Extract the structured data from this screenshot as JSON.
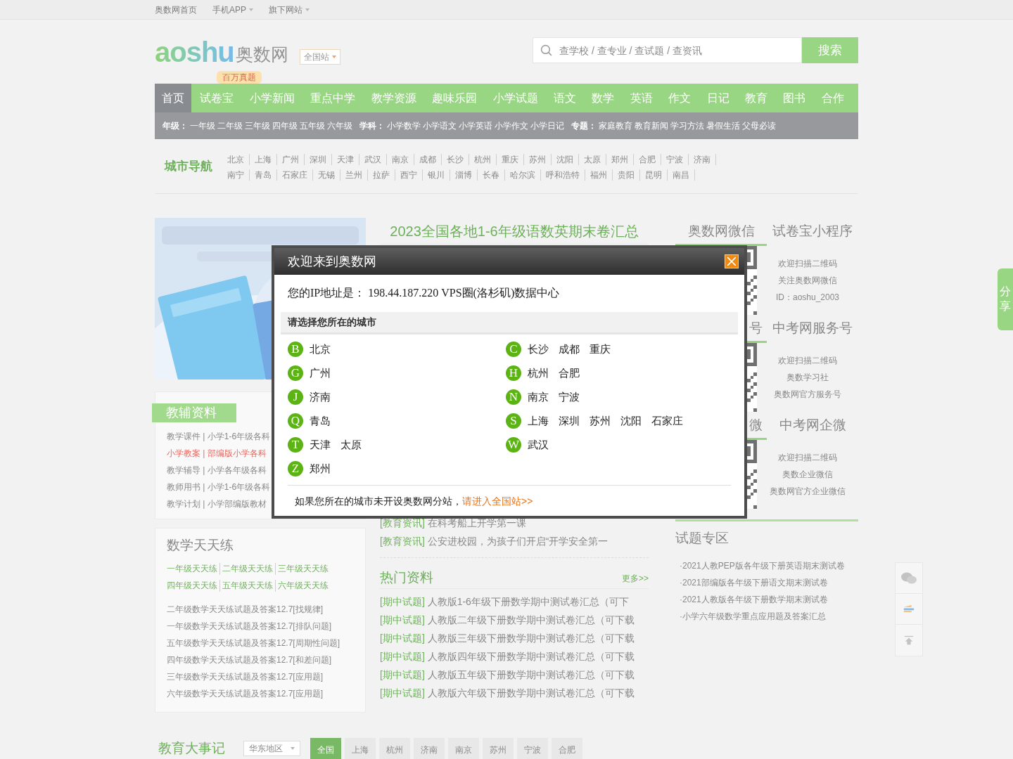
{
  "top_links": [
    {
      "label": "奥数网首页",
      "dropdown": false
    },
    {
      "label": "手机APP",
      "dropdown": true
    },
    {
      "label": "旗下网站",
      "dropdown": true
    }
  ],
  "header": {
    "logo_latin": "aoshu",
    "logo_name": "奥数网",
    "site_selector": "全国站",
    "search_placeholder": "查学校 / 查专业 / 查试题 / 查资讯",
    "search_button": "搜索"
  },
  "nav": [
    {
      "label": "首页",
      "selected": true
    },
    {
      "label": "试卷宝",
      "selected": false,
      "badge": "百万真题"
    },
    {
      "label": "小学新闻",
      "selected": false
    },
    {
      "label": "重点中学",
      "selected": false
    },
    {
      "label": "教学资源",
      "selected": false
    },
    {
      "label": "趣味乐园",
      "selected": false
    },
    {
      "label": "小学试题",
      "selected": false
    },
    {
      "label": "语文",
      "selected": false
    },
    {
      "label": "数学",
      "selected": false
    },
    {
      "label": "英语",
      "selected": false
    },
    {
      "label": "作文",
      "selected": false
    },
    {
      "label": "日记",
      "selected": false
    },
    {
      "label": "教育",
      "selected": false
    },
    {
      "label": "图书",
      "selected": false
    },
    {
      "label": "合作",
      "selected": false
    }
  ],
  "sub_nav": [
    {
      "label": "年级：",
      "links": [
        "一年级",
        "二年级",
        "三年级",
        "四年级",
        "五年级",
        "六年级"
      ]
    },
    {
      "label": "学科：",
      "links": [
        "小学数学",
        "小学语文",
        "小学英语",
        "小学作文",
        "小学日记"
      ]
    },
    {
      "label": "专题：",
      "links": [
        "家庭教育",
        "教育新闻",
        "学习方法",
        "暑假生活",
        "父母必读"
      ]
    }
  ],
  "city_nav": {
    "title": "城市导航",
    "cities": [
      "北京",
      "上海",
      "广州",
      "深圳",
      "天津",
      "武汉",
      "南京",
      "成都",
      "长沙",
      "杭州",
      "重庆",
      "苏州",
      "沈阳",
      "太原",
      "郑州",
      "合肥",
      "宁波",
      "济南",
      "南宁",
      "青岛",
      "石家庄",
      "无锡",
      "兰州",
      "拉萨",
      "西宁",
      "银川",
      "淄博",
      "长春",
      "哈尔滨",
      "呼和浩特",
      "福州",
      "贵阳",
      "昆明",
      "南昌"
    ]
  },
  "tutoring": {
    "title": "教辅资料",
    "items": [
      {
        "text": "教学课件 | 小学1-6年级各科",
        "highlighted": false
      },
      {
        "text": "小学教案 | 部编版小学各科",
        "highlighted": true
      },
      {
        "text": "教学辅导 | 小学各年级各科",
        "highlighted": false
      },
      {
        "text": "教师用书 | 小学1-6年级各科",
        "highlighted": false
      },
      {
        "text": "教学计划 | 小学部编版教材",
        "highlighted": false
      }
    ]
  },
  "daily_practice": {
    "title": "数学天天练",
    "grade_links": [
      [
        "一年级天天练",
        "二年级天天练",
        "三年级天天练"
      ],
      [
        "四年级天天练",
        "五年级天天练",
        "六年级天天练"
      ]
    ],
    "items": [
      "二年级数学天天练试题及答案12.7[找规律]",
      "一年级数学天天练试题及答案12.7[排队问题]",
      "五年级数学天天练试题及答案12.7[周期性问题]",
      "四年级数学天天练试题及答案12.7[和差问题]",
      "三年级数学天天练试题及答案12.7[应用题]",
      "六年级数学天天练试题及答案12.7[应用题]"
    ]
  },
  "headline": "2023全国各地1-6年级语数英期末卷汇总",
  "news": [
    {
      "tag": "[教育资讯]",
      "title": "在科考船上开学第一课"
    },
    {
      "tag": "[教育资讯]",
      "title": "公安进校园，为孩子们开启“开学安全第一"
    }
  ],
  "hot": {
    "title": "热门资料",
    "more": "更多>>",
    "items": [
      {
        "tag": "[期中试题]",
        "title": "人教版1-6年级下册数学期中测试卷汇总（可下"
      },
      {
        "tag": "[期中试题]",
        "title": "人教版二年级下册数学期中测试卷汇总（可下载"
      },
      {
        "tag": "[期中试题]",
        "title": "人教版三年级下册数学期中测试卷汇总（可下载"
      },
      {
        "tag": "[期中试题]",
        "title": "人教版四年级下册数学期中测试卷汇总（可下载"
      },
      {
        "tag": "[期中试题]",
        "title": "人教版五年级下册数学期中测试卷汇总（可下载"
      },
      {
        "tag": "[期中试题]",
        "title": "人教版六年级下册数学期中测试卷汇总（可下载"
      }
    ]
  },
  "qr_groups": [
    {
      "tabs": [
        {
          "label": "奥数网微信",
          "selected": true
        },
        {
          "label": "试卷宝小程序",
          "selected": false
        }
      ],
      "lines": [
        "欢迎扫描二维码",
        "关注奥数网微信",
        "ID：aoshu_2003"
      ]
    },
    {
      "tabs": [
        {
          "label": "号",
          "selected": true
        },
        {
          "label": "中考网服务号",
          "selected": false
        }
      ],
      "lines": [
        "欢迎扫描二维码",
        "奥数学习社",
        "奥数网官方服务号"
      ]
    },
    {
      "tabs": [
        {
          "label": "微",
          "selected": true
        },
        {
          "label": "中考网企微",
          "selected": false
        }
      ],
      "lines": [
        "欢迎扫描二维码",
        "奥数企业微信",
        "奥数网官方企业微信"
      ]
    }
  ],
  "exam_zone": {
    "title": "试题专区",
    "items": [
      "·2021人教PEP版各年级下册英语期末测试卷",
      "·2021部编版各年级下册语文期末测试卷",
      "·2021人教版各年级下册数学期末测试卷",
      "·小学六年级数学重点应用题及答案汇总"
    ]
  },
  "share": "分享",
  "events": {
    "title": "教育大事记",
    "region": "华东地区",
    "tabs": [
      {
        "label": "全国",
        "selected": true
      },
      {
        "label": "上海",
        "selected": false
      },
      {
        "label": "杭州",
        "selected": false
      },
      {
        "label": "济南",
        "selected": false
      },
      {
        "label": "南京",
        "selected": false
      },
      {
        "label": "苏州",
        "selected": false
      },
      {
        "label": "宁波",
        "selected": false
      },
      {
        "label": "合肥",
        "selected": false
      }
    ]
  },
  "modal": {
    "title": "欢迎来到奥数网",
    "ip_line": "您的IP地址是： 198.44.187.220 VPS圈(洛杉矶)数据中心",
    "section_title": "请选择您所在的城市",
    "columns": [
      [
        {
          "letter": "B",
          "cities": [
            "北京"
          ]
        },
        {
          "letter": "G",
          "cities": [
            "广州"
          ]
        },
        {
          "letter": "J",
          "cities": [
            "济南"
          ]
        },
        {
          "letter": "Q",
          "cities": [
            "青岛"
          ]
        },
        {
          "letter": "T",
          "cities": [
            "天津",
            "太原"
          ]
        },
        {
          "letter": "Z",
          "cities": [
            "郑州"
          ]
        }
      ],
      [
        {
          "letter": "C",
          "cities": [
            "长沙",
            "成都",
            "重庆"
          ]
        },
        {
          "letter": "H",
          "cities": [
            "杭州",
            "合肥"
          ]
        },
        {
          "letter": "N",
          "cities": [
            "南京",
            "宁波"
          ]
        },
        {
          "letter": "S",
          "cities": [
            "上海",
            "深圳",
            "苏州",
            "沈阳",
            "石家庄"
          ]
        },
        {
          "letter": "W",
          "cities": [
            "武汉"
          ]
        }
      ]
    ],
    "footer_text": "如果您所在的城市未开设奥数网分站，",
    "footer_link": "请进入全国站>>"
  }
}
